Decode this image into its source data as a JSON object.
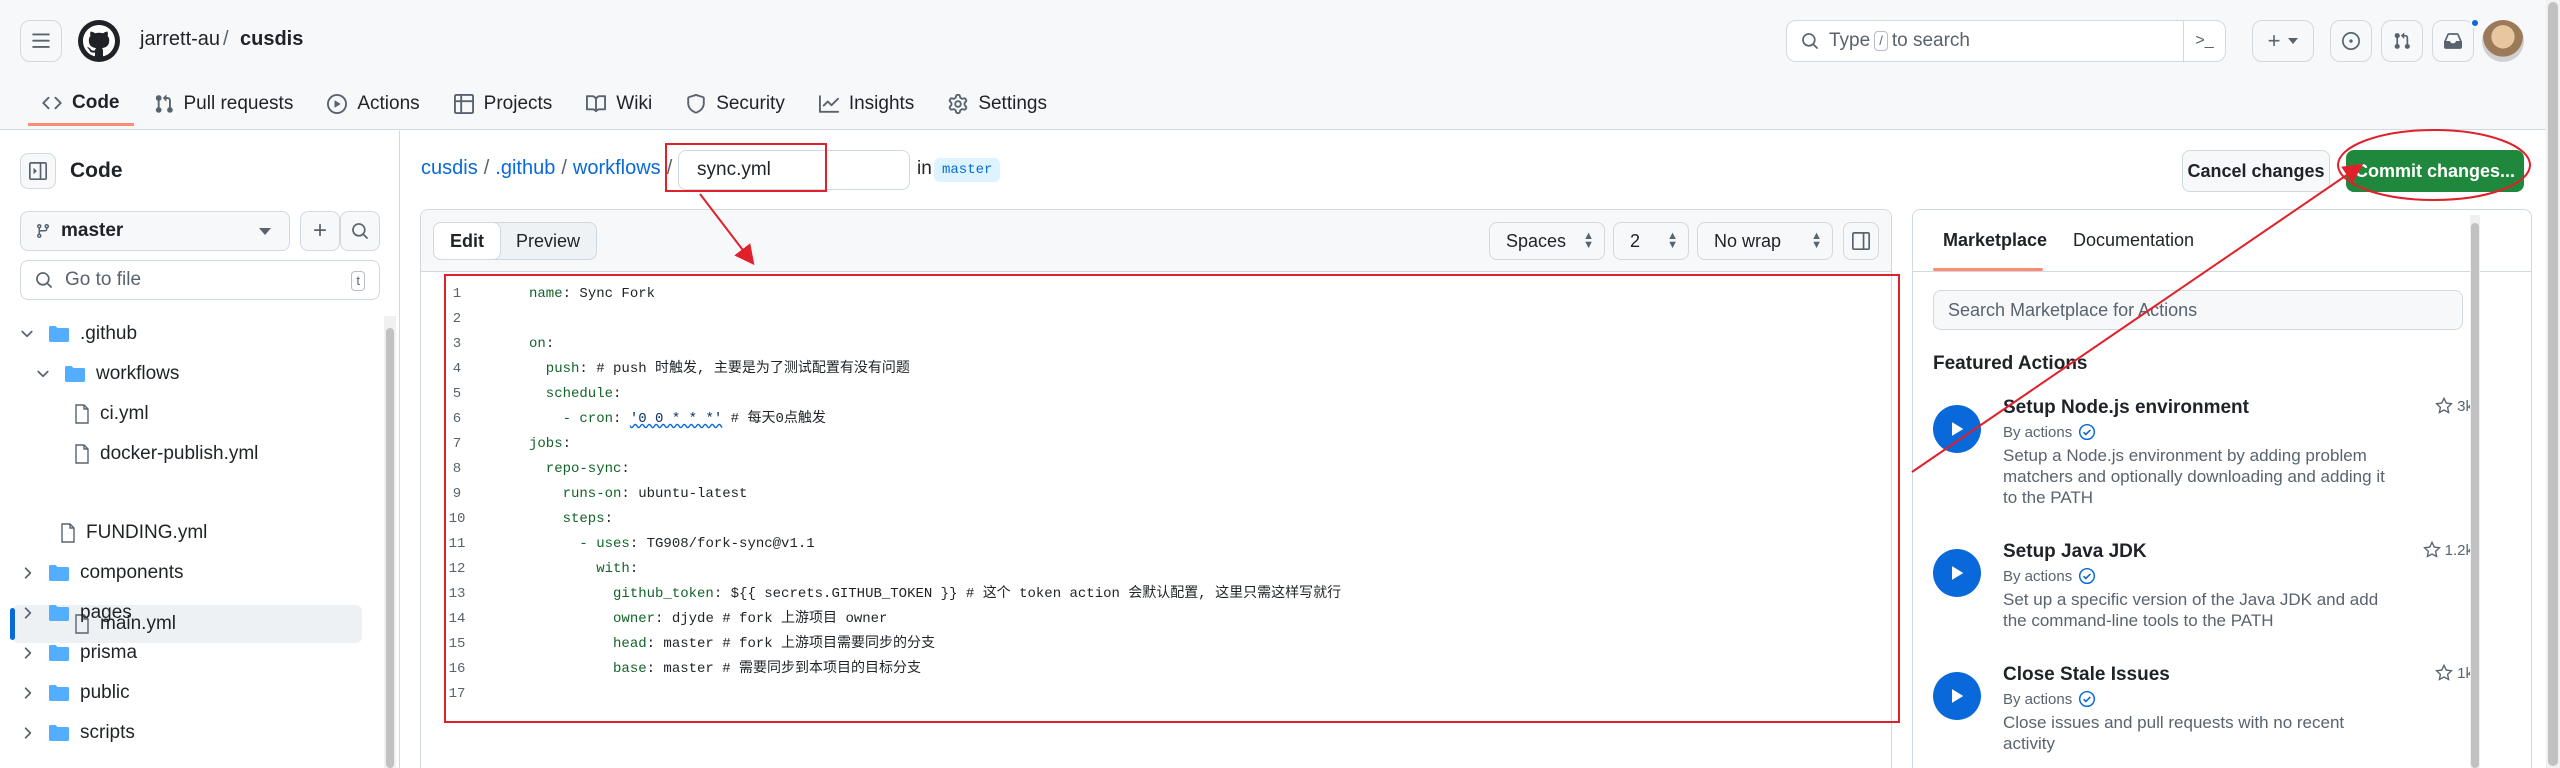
{
  "header": {
    "owner": "jarrett-au",
    "separator": "/",
    "repo": "cusdis",
    "search_prefix": "Type",
    "search_key": "/",
    "search_suffix": "to search",
    "terminal_label": ">_",
    "plus_label": "+"
  },
  "tabs": [
    {
      "label": "Code"
    },
    {
      "label": "Pull requests"
    },
    {
      "label": "Actions"
    },
    {
      "label": "Projects"
    },
    {
      "label": "Wiki"
    },
    {
      "label": "Security"
    },
    {
      "label": "Insights"
    },
    {
      "label": "Settings"
    }
  ],
  "sidebar": {
    "title": "Code",
    "branch": "master",
    "goto_placeholder": "Go to file",
    "goto_key": "t",
    "tree": [
      {
        "label": ".github",
        "kind": "folder"
      },
      {
        "label": "workflows",
        "kind": "folder"
      },
      {
        "label": "ci.yml",
        "kind": "file"
      },
      {
        "label": "docker-publish.yml",
        "kind": "file"
      },
      {
        "label": "main.yml",
        "kind": "file"
      },
      {
        "label": "FUNDING.yml",
        "kind": "file"
      },
      {
        "label": "components",
        "kind": "folder"
      },
      {
        "label": "pages",
        "kind": "folder"
      },
      {
        "label": "prisma",
        "kind": "folder"
      },
      {
        "label": "public",
        "kind": "folder"
      },
      {
        "label": "scripts",
        "kind": "folder"
      }
    ]
  },
  "editor": {
    "path": [
      "cusdis",
      ".github",
      "workflows"
    ],
    "path_sep": "/",
    "filename": "sync.yml",
    "in_label": "in",
    "branch": "master",
    "cancel_label": "Cancel changes",
    "commit_label": "Commit changes...",
    "mode_edit": "Edit",
    "mode_preview": "Preview",
    "indent_mode": "Spaces",
    "indent_size": "2",
    "wrap_mode": "No wrap",
    "lines": [
      {
        "n": "1",
        "key": "name",
        "rest": ": Sync Fork"
      },
      {
        "n": "2",
        "key": "",
        "rest": ""
      },
      {
        "n": "3",
        "key": "on",
        "rest": ":"
      },
      {
        "n": "4",
        "key": "  push",
        "rest": ": # push 时触发, 主要是为了测试配置有没有问题"
      },
      {
        "n": "5",
        "key": "  schedule",
        "rest": ":"
      },
      {
        "n": "6",
        "key": "    - cron",
        "rest": ": ",
        "str": "'0 0 * * *'",
        "tail": " # 每天0点触发"
      },
      {
        "n": "7",
        "key": "jobs",
        "rest": ":"
      },
      {
        "n": "8",
        "key": "  repo-sync",
        "rest": ":"
      },
      {
        "n": "9",
        "key": "    runs-on",
        "rest": ": ubuntu-latest"
      },
      {
        "n": "10",
        "key": "    steps",
        "rest": ":"
      },
      {
        "n": "11",
        "key": "      - uses",
        "rest": ": TG908/fork-sync@v1.1"
      },
      {
        "n": "12",
        "key": "        with",
        "rest": ":"
      },
      {
        "n": "13",
        "key": "          github_token",
        "rest": ": ${{ secrets.GITHUB_TOKEN }} # 这个 token action 会默认配置, 这里只需这样写就行"
      },
      {
        "n": "14",
        "key": "          owner",
        "rest": ": djyde # fork 上游项目 owner"
      },
      {
        "n": "15",
        "key": "          head",
        "rest": ": master # fork 上游项目需要同步的分支"
      },
      {
        "n": "16",
        "key": "          base",
        "rest": ": master # 需要同步到本项目的目标分支"
      },
      {
        "n": "17",
        "key": "",
        "rest": ""
      }
    ]
  },
  "marketplace": {
    "tab_marketplace": "Marketplace",
    "tab_docs": "Documentation",
    "search_placeholder": "Search Marketplace for Actions",
    "featured_title": "Featured Actions",
    "items": [
      {
        "name": "Setup Node.js environment",
        "by": "By actions",
        "desc": "Setup a Node.js environment by adding problem matchers and optionally downloading and adding it to the PATH",
        "stars": "3k"
      },
      {
        "name": "Setup Java JDK",
        "by": "By actions",
        "desc": "Set up a specific version of the Java JDK and add the command-line tools to the PATH",
        "stars": "1.2k"
      },
      {
        "name": "Close Stale Issues",
        "by": "By actions",
        "desc": "Close issues and pull requests with no recent activity",
        "stars": "1k"
      }
    ]
  },
  "colors": {
    "accent": "#0969da",
    "commit_green": "#1f883d",
    "annotation_red": "#e0202a",
    "tab_underline": "#fd8c73"
  }
}
